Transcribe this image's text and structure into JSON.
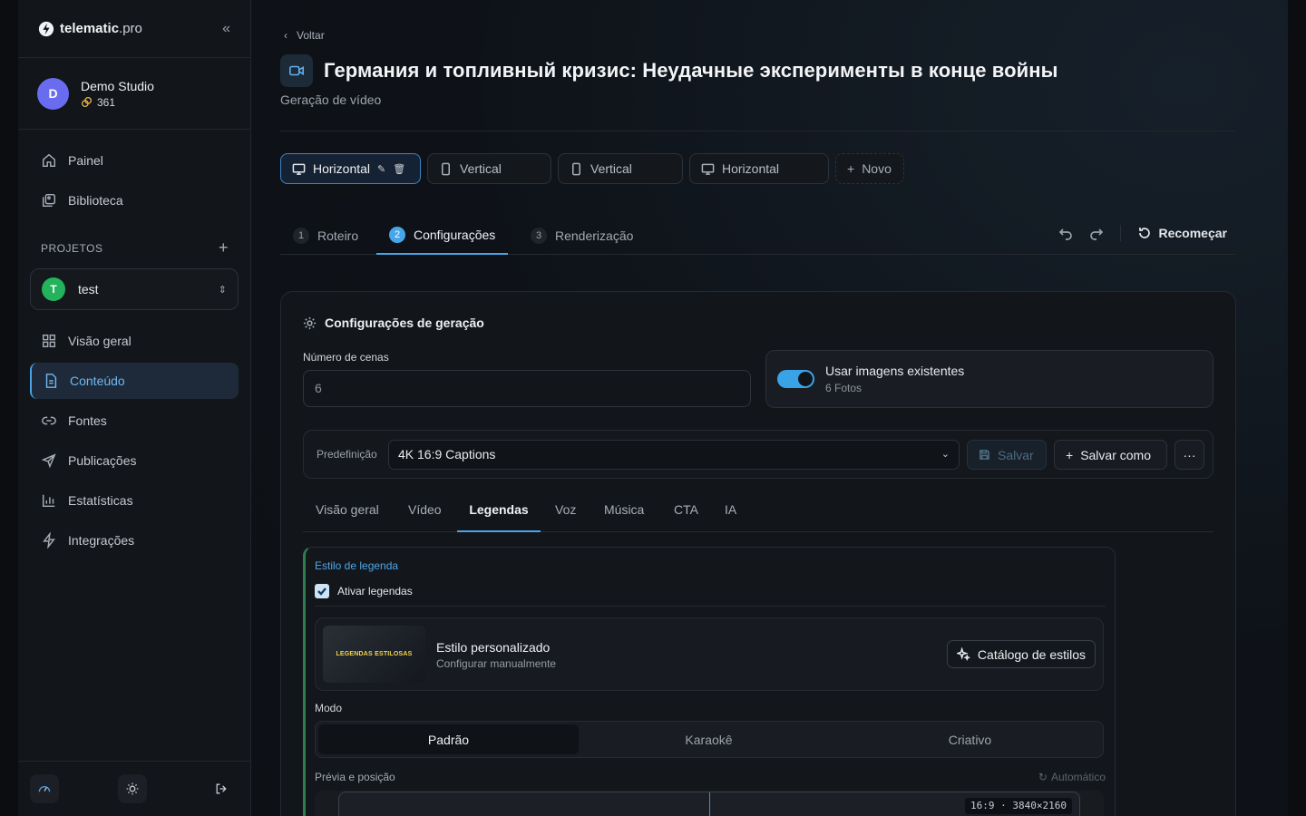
{
  "sidebar": {
    "logo": {
      "brand": "telematic",
      "suffix": ".pro"
    },
    "studio": {
      "avatar_letter": "D",
      "name": "Demo Studio",
      "credits": "361"
    },
    "nav_top": [
      {
        "label": "Painel",
        "icon": "home-icon"
      },
      {
        "label": "Biblioteca",
        "icon": "library-icon"
      }
    ],
    "projects_title": "PROJETOS",
    "project": {
      "letter": "T",
      "name": "test"
    },
    "nav_project": [
      {
        "label": "Visão geral",
        "icon": "grid-icon"
      },
      {
        "label": "Conteúdo",
        "icon": "document-icon",
        "active": true
      },
      {
        "label": "Fontes",
        "icon": "link-icon"
      },
      {
        "label": "Publicações",
        "icon": "send-icon"
      },
      {
        "label": "Estatísticas",
        "icon": "bar-chart-icon"
      },
      {
        "label": "Integrações",
        "icon": "lightning-icon"
      }
    ]
  },
  "header": {
    "back_label": "Voltar",
    "title": "Германия и топливный кризис: Неудачные эксперименты в конце войны",
    "subtitle": "Geração de vídeo"
  },
  "format_tabs": [
    {
      "label": "Horizontal",
      "icon": "monitor-icon",
      "active": true
    },
    {
      "label": "Vertical",
      "icon": "phone-icon"
    },
    {
      "label": "Vertical",
      "icon": "phone-icon"
    },
    {
      "label": "Horizontal",
      "icon": "monitor-icon"
    },
    {
      "label": "Novo",
      "icon": "plus-icon"
    }
  ],
  "steps": [
    {
      "num": "1",
      "label": "Roteiro"
    },
    {
      "num": "2",
      "label": "Configurações",
      "active": true
    },
    {
      "num": "3",
      "label": "Renderização"
    }
  ],
  "restart_label": "Recomeçar",
  "settings": {
    "title": "Configurações de geração",
    "scenes_label": "Número de cenas",
    "scenes_placeholder": "6",
    "use_images_title": "Usar imagens existentes",
    "use_images_sub": "6 Fotos",
    "use_images_on": true,
    "preset_label": "Predefinição",
    "preset_value": "4K 16:9 Captions",
    "save_label": "Salvar",
    "save_as_label": "Salvar como",
    "more_label": "···"
  },
  "subtabs": [
    "Visão geral",
    "Vídeo",
    "Legendas",
    "Voz",
    "Música",
    "CTA",
    "IA"
  ],
  "subtab_active": "Legendas",
  "captions": {
    "section_title": "Estilo de legenda",
    "enable_label": "Ativar legendas",
    "enabled": true,
    "thumb_text": "LEGENDAS ESTILOSAS",
    "style_title": "Estilo personalizado",
    "style_sub": "Configurar manualmente",
    "catalog_label": "Catálogo de estilos",
    "mode_label": "Modo",
    "modes": [
      "Padrão",
      "Karaokê",
      "Criativo"
    ],
    "mode_active": "Padrão",
    "preview_label": "Prévia e posição",
    "auto_label": "Automático",
    "resolution": "16:9 · 3840×2160"
  },
  "colors": {
    "accent": "#47a6ea",
    "project_green": "#22b35c",
    "avatar_purple": "#6a6cf0"
  }
}
